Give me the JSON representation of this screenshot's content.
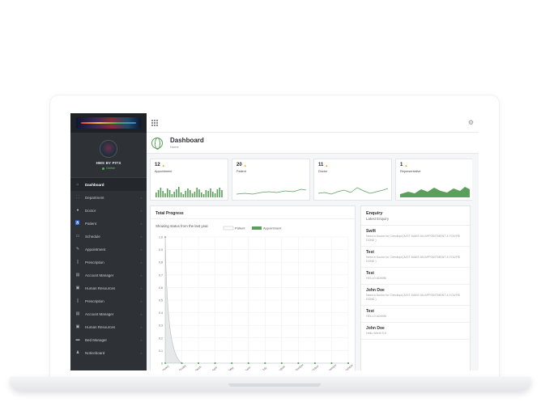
{
  "sidebar": {
    "user_name": "HMS BY PITS",
    "user_status": "Online",
    "items": [
      {
        "label": "Dashboard",
        "icon": "home-icon",
        "glyph": "⌂",
        "active": true,
        "arrow": ""
      },
      {
        "label": "Department",
        "icon": "sitemap-icon",
        "glyph": "⸬",
        "active": false,
        "arrow": "‹"
      },
      {
        "label": "Doctor",
        "icon": "user-icon",
        "glyph": "●",
        "active": false,
        "arrow": "‹"
      },
      {
        "label": "Patient",
        "icon": "wheelchair-icon",
        "glyph": "♿",
        "active": false,
        "arrow": "‹"
      },
      {
        "label": "Schedule",
        "icon": "calendar-icon",
        "glyph": "▭",
        "active": false,
        "arrow": "‹"
      },
      {
        "label": "Appointment",
        "icon": "edit-icon",
        "glyph": "✎",
        "active": false,
        "arrow": "‹"
      },
      {
        "label": "Prescription",
        "icon": "book-icon",
        "glyph": "▯",
        "active": false,
        "arrow": "‹"
      },
      {
        "label": "Account Manager",
        "icon": "money-icon",
        "glyph": "▤",
        "active": false,
        "arrow": "‹"
      },
      {
        "label": "Human Resources",
        "icon": "users-icon",
        "glyph": "▣",
        "active": false,
        "arrow": "‹"
      },
      {
        "label": "Prescription",
        "icon": "book-icon",
        "glyph": "▯",
        "active": false,
        "arrow": "‹"
      },
      {
        "label": "Account Manager",
        "icon": "money-icon",
        "glyph": "▤",
        "active": false,
        "arrow": "‹"
      },
      {
        "label": "Human Resources",
        "icon": "users-icon",
        "glyph": "▣",
        "active": false,
        "arrow": "‹"
      },
      {
        "label": "Bed Manager",
        "icon": "bed-icon",
        "glyph": "▬",
        "active": false,
        "arrow": "‹"
      },
      {
        "label": "Noticeboard",
        "icon": "bell-icon",
        "glyph": "♟",
        "active": false,
        "arrow": "‹"
      }
    ]
  },
  "page": {
    "title": "Dashboard",
    "breadcrumb": "Home"
  },
  "stats": [
    {
      "value": "12",
      "label": "Appointment",
      "spark": "bars",
      "color": "#5aa05a"
    },
    {
      "value": "20",
      "label": "Patient",
      "spark": "line",
      "color": "#5aa05a"
    },
    {
      "value": "11",
      "label": "Doctor",
      "spark": "line",
      "color": "#5aa05a"
    },
    {
      "value": "1",
      "label": "Representative",
      "spark": "area",
      "color": "#5aa05a"
    }
  ],
  "progress": {
    "title": "Total Progress",
    "subtitle": "Showing status from the last year"
  },
  "chart_data": {
    "type": "line",
    "title": "",
    "legend": [
      "Patient",
      "Appointment"
    ],
    "legend_position": "top",
    "grid": true,
    "y_ticks": [
      "1.0",
      "0.9",
      "0.8",
      "0.7",
      "0.6",
      "0.5",
      "0.4",
      "0.3",
      "0.2",
      "0.1",
      "0"
    ],
    "y_ticks_lower": [
      "0.7",
      "0.6",
      "0.5",
      "0.4",
      "0.3",
      "0.2",
      "0.1",
      "0"
    ],
    "categories": [
      "January",
      "February",
      "March",
      "April",
      "May",
      "June",
      "July",
      "August",
      "September",
      "October",
      "November",
      "December"
    ],
    "series": [
      {
        "name": "Patient",
        "values": [
          1,
          0,
          0,
          0,
          0,
          0,
          0,
          0,
          0,
          0,
          0,
          0
        ],
        "color": "#c9cdd1"
      },
      {
        "name": "Appointment",
        "values": [
          0,
          0,
          0,
          0,
          0,
          0,
          0,
          0,
          0,
          0,
          0,
          0
        ],
        "color": "#5aa05a"
      }
    ],
    "ylim": [
      0,
      1
    ]
  },
  "enquiry": {
    "title": "Enquiry",
    "subtitle": "Latest Enquiry",
    "items": [
      {
        "name": "Swift",
        "message": "Need a Doctor for Checkup!(JUST MAKE AN APPOINTMENT & YOU'RE DONE )"
      },
      {
        "name": "Test",
        "message": "Need a Doctor for Checkup!(JUST MAKE AN APPOINTMENT & YOU'RE DONE )"
      },
      {
        "name": "Test",
        "message": "HELLO ADMIN!"
      },
      {
        "name": "John Doe",
        "message": "Need a Doctor for Checkup!(JUST MAKE AN APPOINTMENT & YOU'RE DONE )"
      },
      {
        "name": "Test",
        "message": "HELLO ADMIN!"
      },
      {
        "name": "John Doe",
        "message": "Hello Worth 5,5"
      }
    ]
  }
}
